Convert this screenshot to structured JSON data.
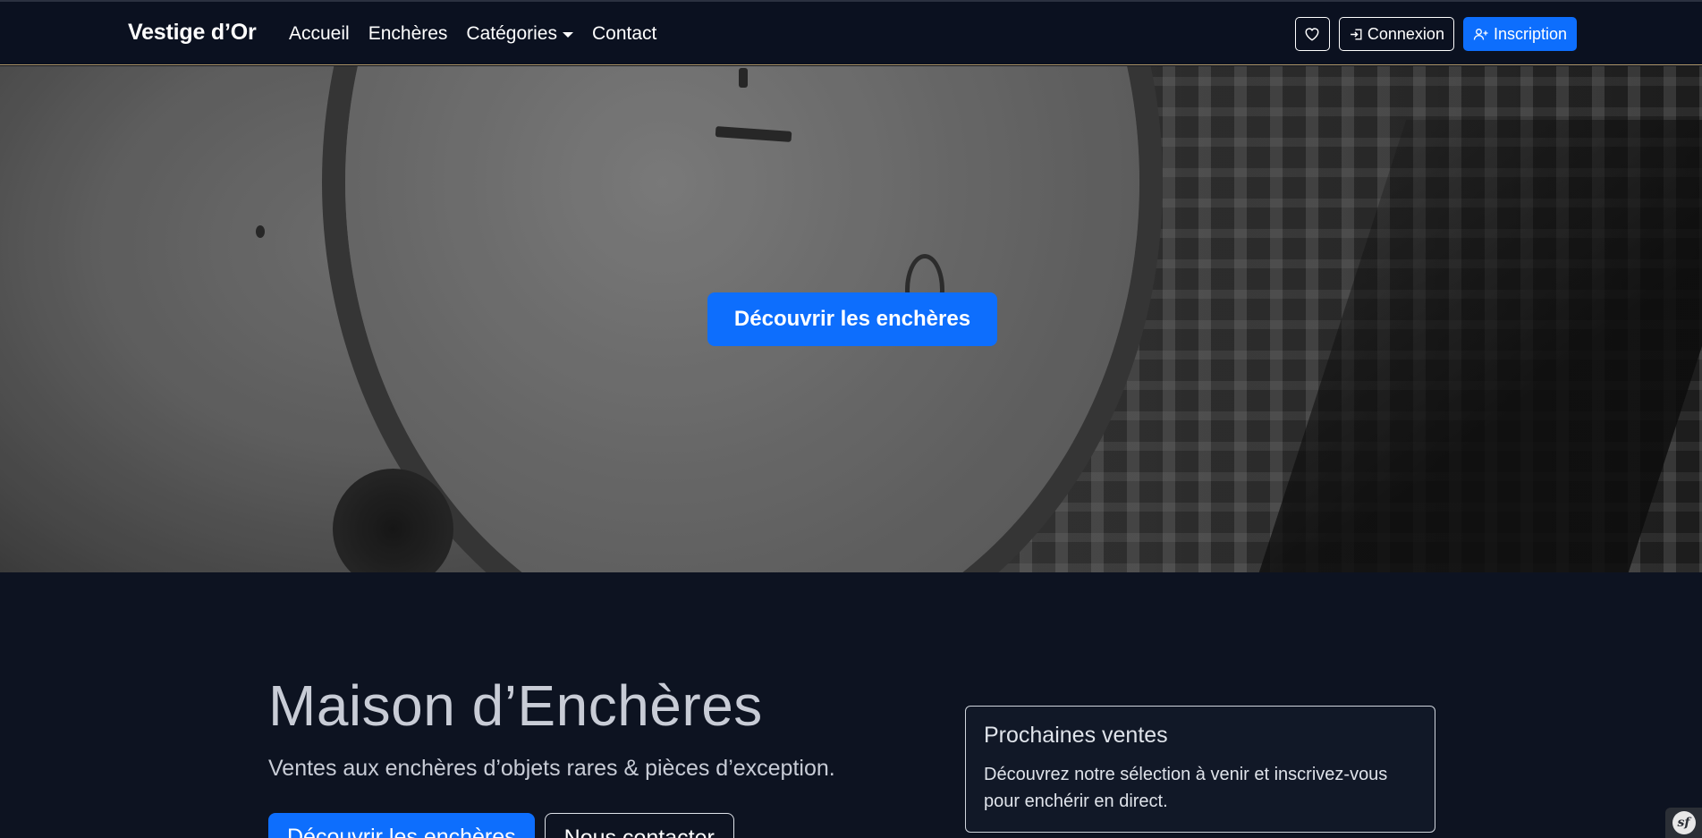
{
  "navbar": {
    "brand": "Vestige d’Or",
    "links": [
      {
        "label": "Accueil"
      },
      {
        "label": "Enchères"
      },
      {
        "label": "Catégories"
      },
      {
        "label": "Contact"
      }
    ],
    "favorites_icon": "heart-icon",
    "login_label": "Connexion",
    "login_icon": "sign-in-icon",
    "signup_label": "Inscription",
    "signup_icon": "user-plus-icon"
  },
  "hero": {
    "cta_label": "Découvrir les enchères"
  },
  "main": {
    "title": "Maison d’Enchères",
    "subtitle": "Ventes aux enchères d’objets rares & pièces d’exception.",
    "primary_button": "Découvrir les enchères",
    "secondary_button": "Nous contacter"
  },
  "card": {
    "title": "Prochaines ventes",
    "text": "Découvrez notre sélection à venir et inscrivez-vous pour enchérir en direct."
  },
  "debug_toolbar": {
    "label": "sf"
  },
  "colors": {
    "primary": "#0d6efd",
    "background": "#0d1321",
    "navbar": "#0b1120",
    "accent_border": "#b59b6a"
  }
}
